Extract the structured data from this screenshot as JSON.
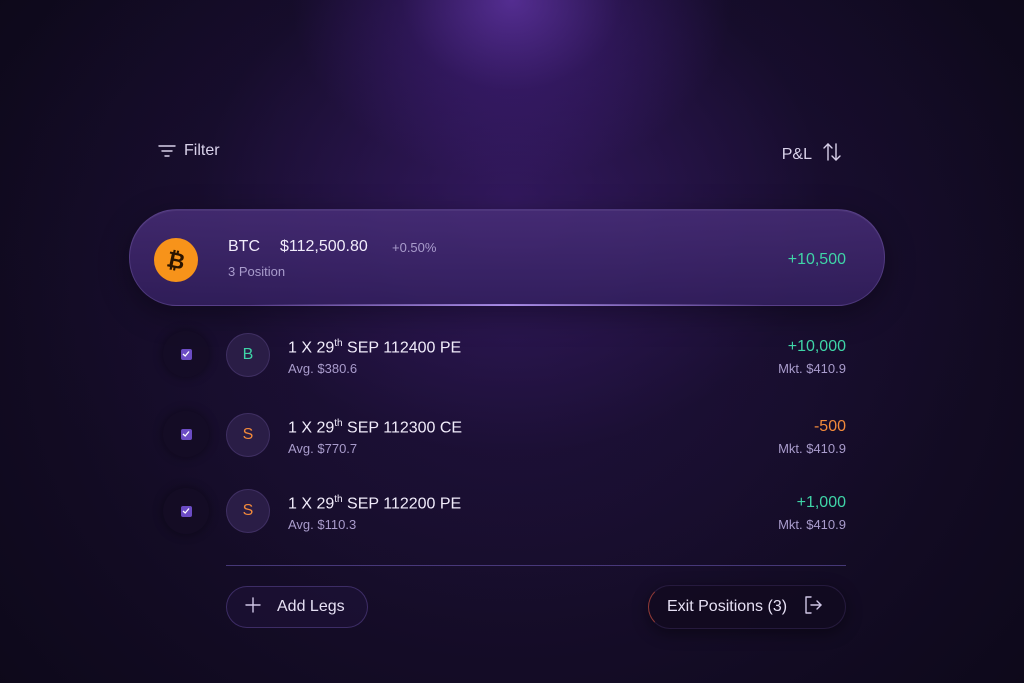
{
  "toolbar": {
    "filter_label": "Filter",
    "sort_label": "P&L"
  },
  "underlying": {
    "symbol": "BTC",
    "price": "$112,500.80",
    "change": "+0.50%",
    "positions": "3 Position",
    "pnl": "+10,500"
  },
  "legs": [
    {
      "checked": true,
      "side": "B",
      "qty": "1 X 29",
      "sup": "th",
      "contract": " SEP 112400 PE",
      "avg": "Avg. $380.6",
      "pnl": "+10,000",
      "mkt": "Mkt. $410.9"
    },
    {
      "checked": true,
      "side": "S",
      "qty": "1 X 29",
      "sup": "th",
      "contract": " SEP 112300 CE",
      "avg": "Avg. $770.7",
      "pnl": "-500",
      "mkt": "Mkt. $410.9"
    },
    {
      "checked": true,
      "side": "S",
      "qty": "1 X 29",
      "sup": "th",
      "contract": " SEP 112200 PE",
      "avg": "Avg. $110.3",
      "pnl": "+1,000",
      "mkt": "Mkt. $410.9"
    }
  ],
  "actions": {
    "add_legs": "Add Legs",
    "exit_positions": "Exit Positions (3)"
  },
  "colors": {
    "profit": "#3fd4a7",
    "loss": "#f28a3b",
    "bitcoin": "#f7931a",
    "accent": "#6b4cc4"
  },
  "icons": [
    "filter-icon",
    "sort-icon",
    "bitcoin-icon",
    "check-icon",
    "plus-icon",
    "exit-icon"
  ]
}
